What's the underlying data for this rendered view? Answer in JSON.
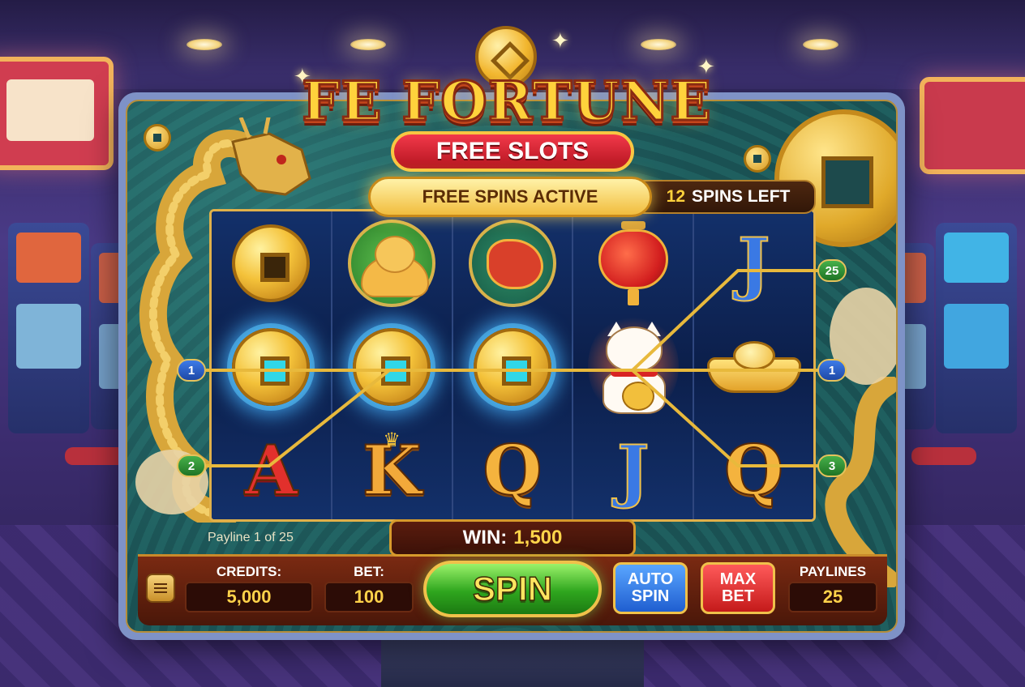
{
  "game": {
    "title": "FE FORTUNE",
    "subtitle": "FREE SLOTS"
  },
  "free_spins": {
    "banner": "FREE SPINS ACTIVE",
    "count": "12",
    "suffix": "SPINS LEFT"
  },
  "reels": [
    [
      "gold-coin",
      "gold-coin",
      "letter-A"
    ],
    [
      "buddha",
      "gold-coin",
      "letter-K"
    ],
    [
      "dragon",
      "gold-coin",
      "letter-Q"
    ],
    [
      "lantern",
      "lucky-cat",
      "letter-J"
    ],
    [
      "letter-J",
      "gold-ingot",
      "letter-Q"
    ]
  ],
  "symbol_letters": {
    "A": "A",
    "K": "K",
    "Q": "Q",
    "J": "J"
  },
  "paylines": {
    "left": [
      "1",
      "2"
    ],
    "right": [
      "25",
      "1",
      "3"
    ],
    "info": "Payline 1 of 25"
  },
  "win": {
    "label": "WIN:",
    "value": "1,500"
  },
  "controls": {
    "credits_label": "CREDITS:",
    "credits_value": "5,000",
    "bet_label": "BET:",
    "bet_value": "100",
    "spin_label": "SPIN",
    "auto_spin_line1": "AUTO",
    "auto_spin_line2": "SPIN",
    "max_bet_line1": "MAX",
    "max_bet_line2": "BET",
    "paylines_label": "PAYLINES",
    "paylines_value": "25"
  },
  "colors": {
    "accent_gold": "#ffd23c",
    "win_glow": "#46b4ff",
    "spin_green": "#2fa61e",
    "max_bet_red": "#c41a1a",
    "auto_spin_blue": "#1f5ed0"
  }
}
